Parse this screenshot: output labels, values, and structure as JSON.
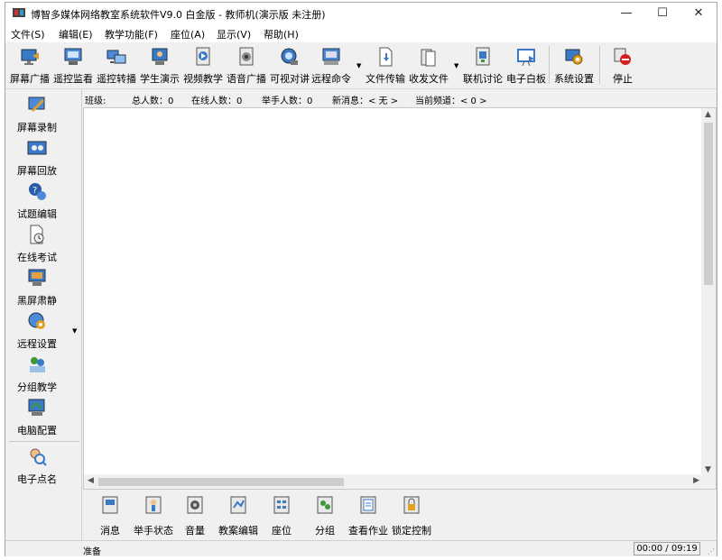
{
  "window": {
    "title": "博智多媒体网络教室系统软件V9.0 白金版 - 教师机(演示版 未注册)",
    "minimize": "—",
    "maximize": "☐",
    "close": "✕"
  },
  "menu": [
    {
      "label": "文件(S)"
    },
    {
      "label": "编辑(E)"
    },
    {
      "label": "教学功能(F)"
    },
    {
      "label": "座位(A)"
    },
    {
      "label": "显示(V)"
    },
    {
      "label": "帮助(H)"
    }
  ],
  "toolbar": [
    {
      "label": "屏幕广播",
      "icon": "screen-broadcast-icon"
    },
    {
      "label": "遥控监看",
      "icon": "remote-monitor-icon"
    },
    {
      "label": "遥控转播",
      "icon": "remote-relay-icon"
    },
    {
      "label": "学生演示",
      "icon": "student-demo-icon"
    },
    {
      "label": "视频教学",
      "icon": "video-teaching-icon"
    },
    {
      "label": "语音广播",
      "icon": "voice-broadcast-icon"
    },
    {
      "label": "可视对讲",
      "icon": "video-intercom-icon"
    },
    {
      "label": "远程命令",
      "icon": "remote-command-icon"
    },
    {
      "label": "文件传输",
      "icon": "file-transfer-icon"
    },
    {
      "label": "收发文件",
      "icon": "send-receive-file-icon"
    },
    {
      "label": "联机讨论",
      "icon": "online-discussion-icon"
    },
    {
      "label": "电子白板",
      "icon": "whiteboard-icon"
    },
    {
      "label": "系统设置",
      "icon": "system-settings-icon"
    },
    {
      "label": "停止",
      "icon": "stop-icon"
    }
  ],
  "left_panel": [
    {
      "label": "屏幕录制",
      "icon": "screen-record-icon"
    },
    {
      "label": "屏幕回放",
      "icon": "screen-playback-icon"
    },
    {
      "label": "试题编辑",
      "icon": "exam-edit-icon"
    },
    {
      "label": "在线考试",
      "icon": "online-exam-icon"
    },
    {
      "label": "黑屏肃静",
      "icon": "black-screen-icon"
    },
    {
      "label": "远程设置",
      "icon": "remote-settings-icon"
    },
    {
      "label": "分组教学",
      "icon": "group-teaching-icon"
    },
    {
      "label": "电脑配置",
      "icon": "computer-config-icon"
    },
    {
      "label": "电子点名",
      "icon": "roll-call-icon"
    }
  ],
  "info": {
    "class_label": "班级:",
    "total": "总人数：0",
    "online": "在线人数：0",
    "hands": "举手人数：0",
    "new_msg": "新消息：< 无 >",
    "channel": "当前频道：< 0 >"
  },
  "bottom_toolbar": [
    {
      "label": "消息",
      "icon": "message-icon"
    },
    {
      "label": "举手状态",
      "icon": "hand-raise-icon"
    },
    {
      "label": "音量",
      "icon": "volume-icon"
    },
    {
      "label": "教案编辑",
      "icon": "lesson-plan-icon"
    },
    {
      "label": "座位",
      "icon": "seat-icon"
    },
    {
      "label": "分组",
      "icon": "group-icon"
    },
    {
      "label": "查看作业",
      "icon": "homework-icon"
    },
    {
      "label": "锁定控制",
      "icon": "lock-control-icon"
    }
  ],
  "status": {
    "text": "准备",
    "time": "00:00 / 09:19"
  },
  "colors": {
    "blue": "#3a78c8",
    "green": "#3a9a3a",
    "red": "#d32020",
    "gray": "#888888"
  }
}
